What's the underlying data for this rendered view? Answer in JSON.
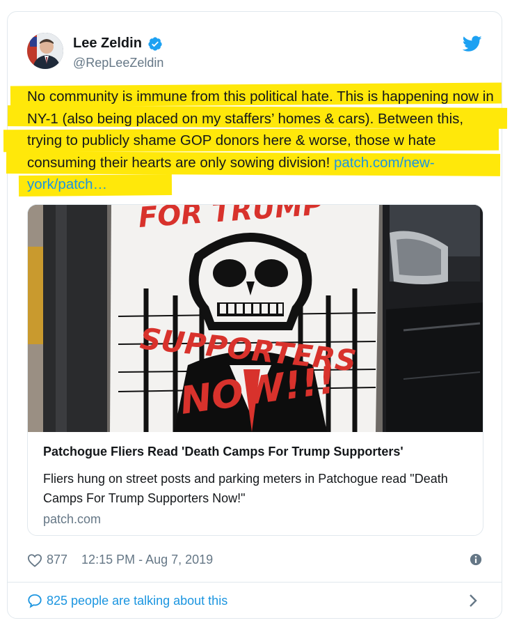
{
  "author": {
    "display_name": "Lee Zeldin",
    "handle": "@RepLeeZeldin",
    "verified": true
  },
  "tweet": {
    "text": "No community is immune from this political hate. This is happening now in NY-1 (also being placed on my staffers’ homes & cars). Between this, trying to publicly shame GOP donors here & worse, those w hate consuming their hearts are only sowing division!",
    "link_text": "patch.com/new-york/patch…",
    "highlight_color": "#ffe80a"
  },
  "link_card": {
    "title": "Patchogue Fliers Read 'Death Camps For Trump Supporters'",
    "description": "Fliers hung on street posts and parking meters in Patchogue read \"Death Camps For Trump Supporters Now!\"",
    "domain": "patch.com",
    "image_text": {
      "line1": "FOR TRUMP",
      "line2": "SUPPORTERS",
      "line3": "NOW!!!"
    }
  },
  "meta": {
    "like_count": "877",
    "timestamp": "12:15 PM - Aug 7, 2019"
  },
  "footer": {
    "talking_text": "825 people are talking about this"
  },
  "icons": {
    "twitter": "twitter-bird-icon",
    "verified": "verified-badge-icon",
    "heart": "heart-icon",
    "info": "info-icon",
    "comment": "speech-bubble-icon",
    "chevron": "chevron-right-icon"
  },
  "colors": {
    "twitter_blue": "#1da1f2",
    "link_blue": "#1b95e0",
    "text": "#14171a",
    "muted": "#657786",
    "border": "#e1e8ed",
    "poster_red": "#d8322c"
  }
}
